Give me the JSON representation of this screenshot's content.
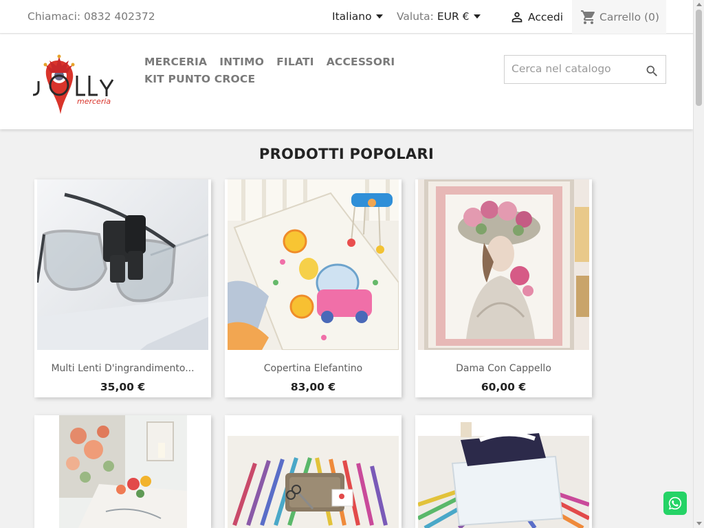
{
  "topbar": {
    "phone": "Chiamaci: 0832 402372",
    "language": "Italiano",
    "currency_label": "Valuta:",
    "currency_value": "EUR €",
    "login": "Accedi",
    "cart": "Carrello (0)"
  },
  "header": {
    "logo_text": "Jolly",
    "logo_subtext": "merceria",
    "menu": [
      "Merceria",
      "Intimo",
      "Filati",
      "Accessori",
      "Kit Punto Croce"
    ],
    "search_placeholder": "Cerca nel catalogo"
  },
  "section": {
    "title": "PRODOTTI POPOLARI"
  },
  "products": [
    {
      "name": "Multi Lenti D'ingrandimento...",
      "price": "35,00 €"
    },
    {
      "name": "Copertina Elefantino",
      "price": "83,00 €"
    },
    {
      "name": "Dama Con Cappello",
      "price": "60,00 €"
    },
    {
      "name": "",
      "price": ""
    },
    {
      "name": "",
      "price": ""
    },
    {
      "name": "",
      "price": ""
    }
  ],
  "colors": {
    "accent": "#d9342b",
    "text": "#232323",
    "muted": "#7a7a7a",
    "whatsapp": "#25d366"
  }
}
